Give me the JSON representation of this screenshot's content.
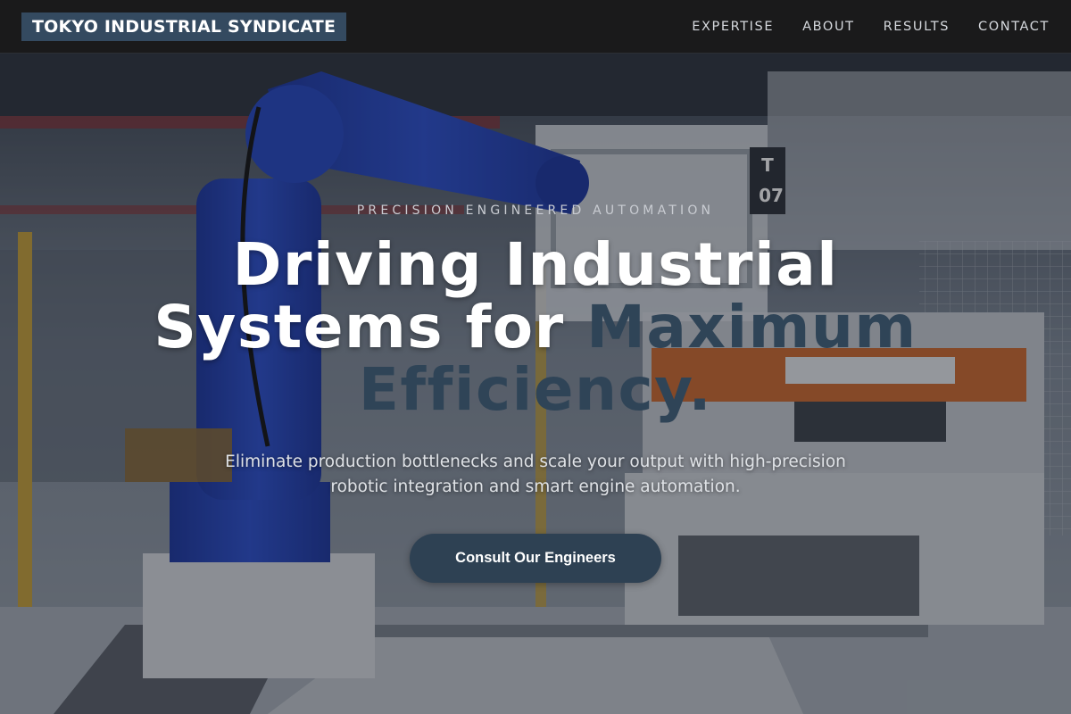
{
  "nav": {
    "brand": "TOKYO INDUSTRIAL SYNDICATE",
    "links": [
      "EXPERTISE",
      "ABOUT",
      "RESULTS",
      "CONTACT"
    ]
  },
  "hero": {
    "eyebrow": "PRECISION ENGINEERED AUTOMATION",
    "headline_main": "Driving Industrial Systems for ",
    "headline_accent": "Maximum Efficiency.",
    "subtitle": "Eliminate production bottlenecks and scale your output with high-precision robotic integration and smart engine automation.",
    "cta_label": "Consult Our Engineers",
    "station_sign": "T 07"
  },
  "colors": {
    "nav_background": "#1a1a1b",
    "brand_background": "#344a60",
    "accent_text": "#2f4457",
    "cta_background": "#2e4153"
  }
}
